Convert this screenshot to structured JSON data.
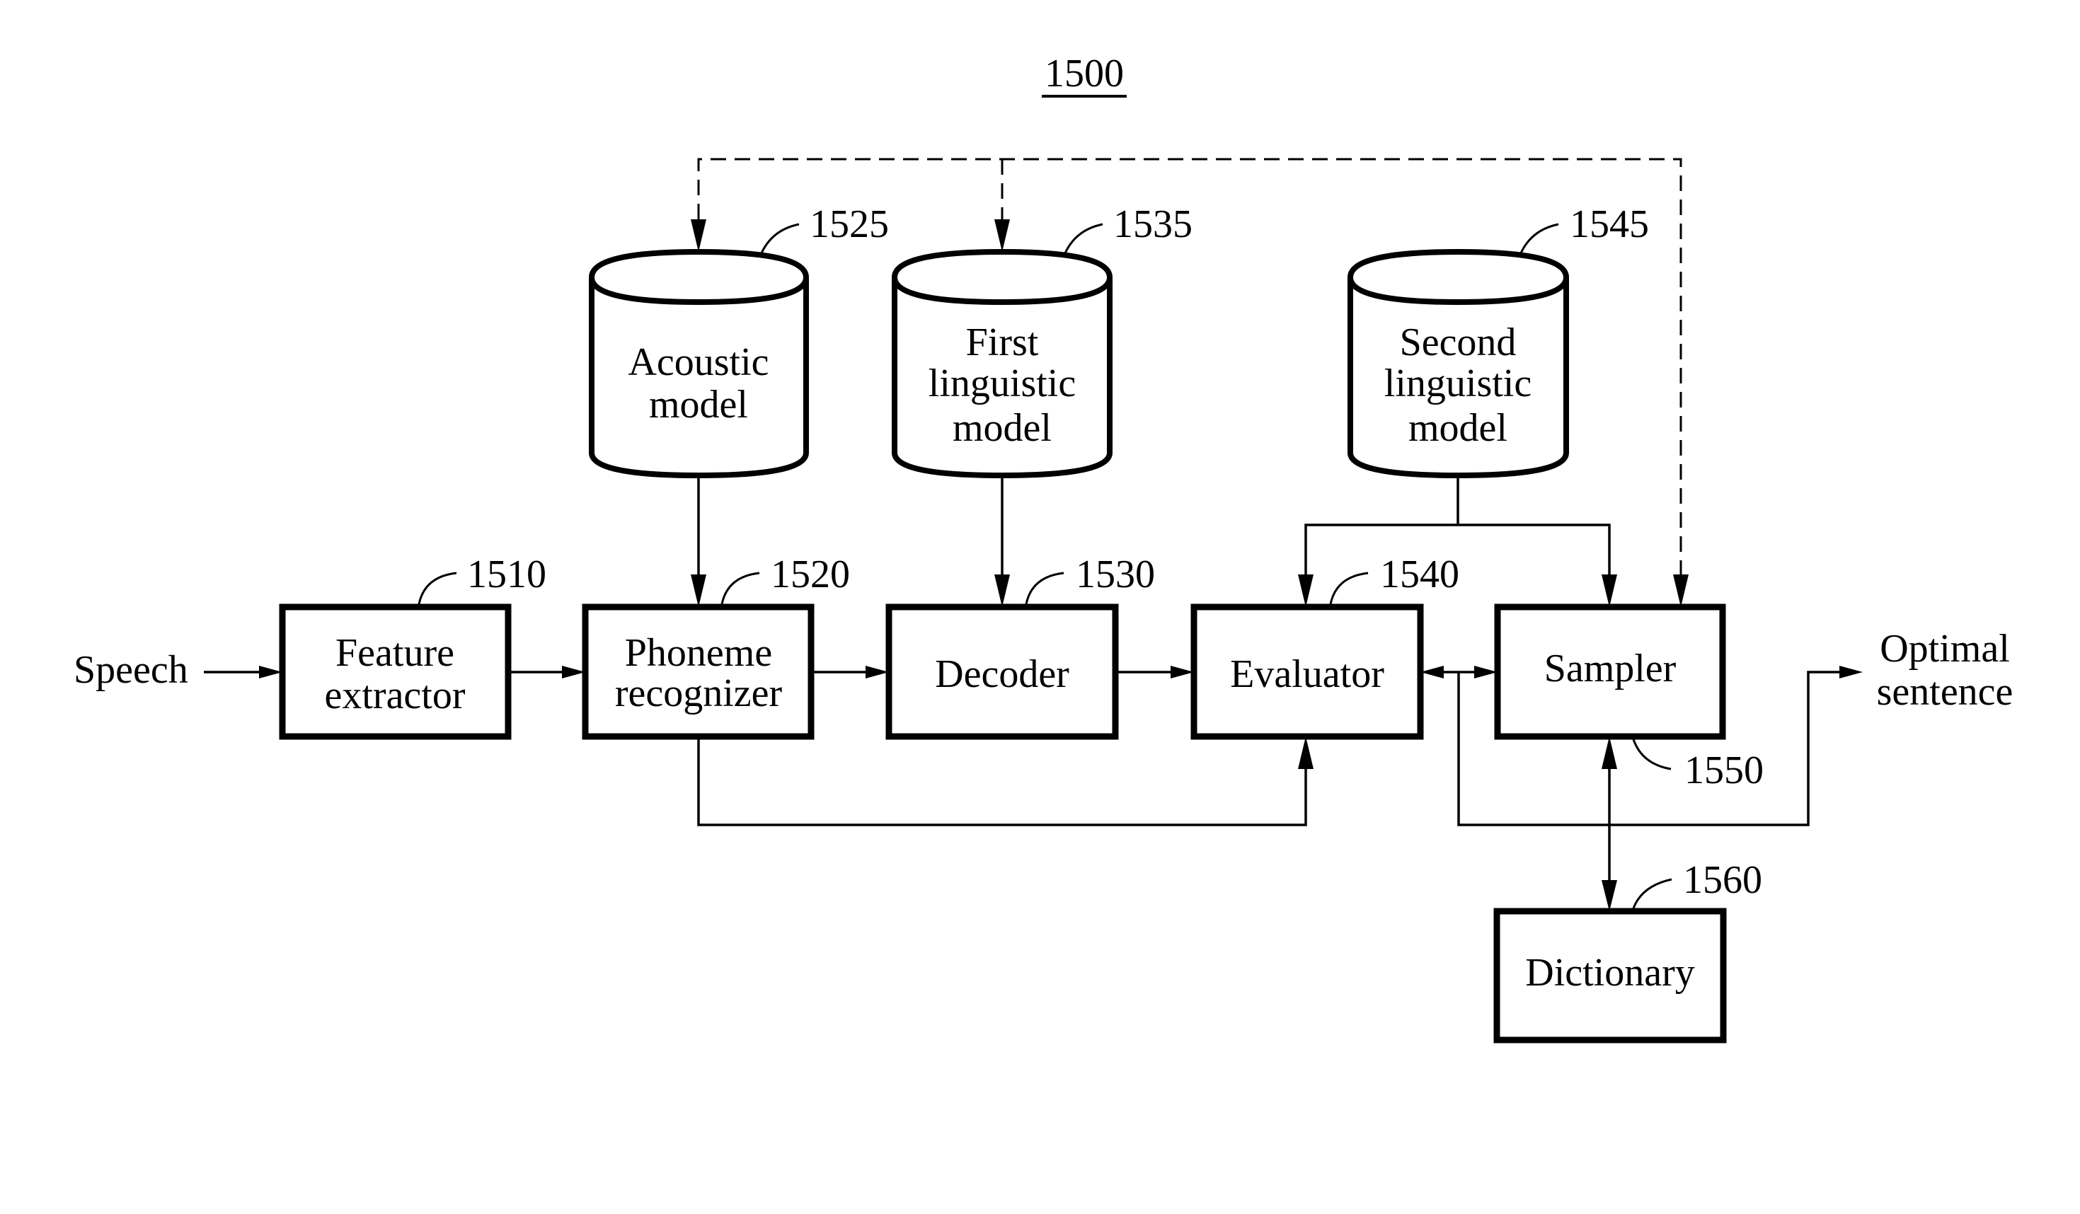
{
  "figure": {
    "number": "1500"
  },
  "blocks": {
    "feature_extractor": {
      "ref": "1510",
      "lines": [
        "Feature",
        "extractor"
      ]
    },
    "phoneme_recognizer": {
      "ref": "1520",
      "lines": [
        "Phoneme",
        "recognizer"
      ]
    },
    "decoder": {
      "ref": "1530",
      "lines": [
        "Decoder"
      ]
    },
    "evaluator": {
      "ref": "1540",
      "lines": [
        "Evaluator"
      ]
    },
    "sampler": {
      "ref": "1550",
      "lines": [
        "Sampler"
      ]
    },
    "dictionary": {
      "ref": "1560",
      "lines": [
        "Dictionary"
      ]
    }
  },
  "databases": {
    "acoustic_model": {
      "ref": "1525",
      "lines": [
        "Acoustic",
        "model"
      ]
    },
    "first_linguistic_model": {
      "ref": "1535",
      "lines": [
        "First",
        "linguistic",
        "model"
      ]
    },
    "second_linguistic_model": {
      "ref": "1545",
      "lines": [
        "Second",
        "linguistic",
        "model"
      ]
    }
  },
  "io": {
    "input": "Speech",
    "output_lines": [
      "Optimal",
      "sentence"
    ]
  },
  "connections": [
    {
      "from": "Speech",
      "to": "Feature extractor",
      "style": "solid"
    },
    {
      "from": "Feature extractor",
      "to": "Phoneme recognizer",
      "style": "solid"
    },
    {
      "from": "Phoneme recognizer",
      "to": "Decoder",
      "style": "solid"
    },
    {
      "from": "Decoder",
      "to": "Evaluator",
      "style": "solid"
    },
    {
      "from": "Phoneme recognizer",
      "to": "Evaluator",
      "style": "solid"
    },
    {
      "from": "Evaluator",
      "to": "Sampler",
      "style": "solid",
      "bidirectional": true
    },
    {
      "from": "Acoustic model",
      "to": "Phoneme recognizer",
      "style": "solid"
    },
    {
      "from": "First linguistic model",
      "to": "Decoder",
      "style": "solid"
    },
    {
      "from": "Second linguistic model",
      "to": "Evaluator",
      "style": "solid"
    },
    {
      "from": "Second linguistic model",
      "to": "Sampler",
      "style": "solid"
    },
    {
      "from": "Sampler",
      "to": "Dictionary",
      "style": "solid",
      "bidirectional": true
    },
    {
      "from": "Evaluator/Sampler",
      "to": "Optimal sentence",
      "style": "solid"
    },
    {
      "from": "Sampler",
      "to": "Acoustic model",
      "style": "dashed"
    },
    {
      "from": "Sampler",
      "to": "First linguistic model",
      "style": "dashed"
    }
  ]
}
